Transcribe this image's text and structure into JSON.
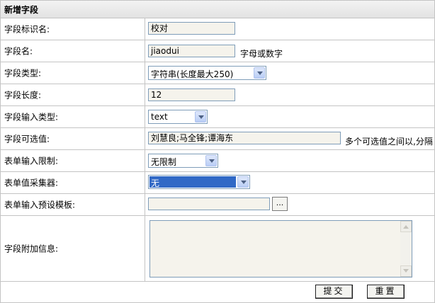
{
  "header": {
    "title": "新增字段"
  },
  "rows": {
    "display_name": {
      "label": "字段标识名:",
      "value": "校对"
    },
    "field_name": {
      "label": "字段名:",
      "value": "jiaodui",
      "hint": "字母或数字"
    },
    "field_type": {
      "label": "字段类型:",
      "selected": "字符串(长度最大250)"
    },
    "field_length": {
      "label": "字段长度:",
      "value": "12"
    },
    "input_type": {
      "label": "字段输入类型:",
      "selected": "text"
    },
    "options": {
      "label": "字段可选值:",
      "value": "刘慧良;马全锋;谭海东",
      "hint": "多个可选值之间以,分隔"
    },
    "input_limit": {
      "label": "表单输入限制:",
      "selected": "无限制"
    },
    "collector": {
      "label": "表单值采集器:",
      "selected": "无"
    },
    "preset_template": {
      "label": "表单输入预设模板:",
      "value": "",
      "browse_label": "..."
    },
    "extra_info": {
      "label": "字段附加信息:",
      "value": ""
    }
  },
  "actions": {
    "submit_label": "提交",
    "reset_label": "重置"
  }
}
